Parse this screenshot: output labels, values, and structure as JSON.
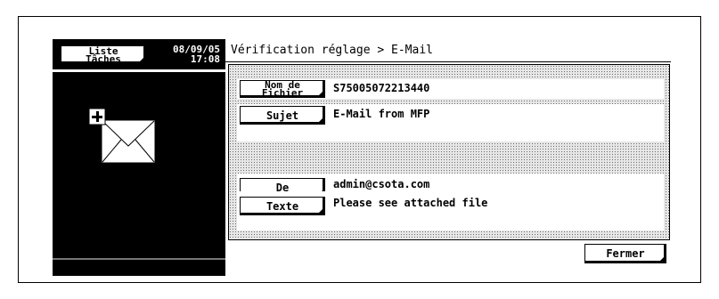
{
  "header": {
    "liste_line1": "Liste",
    "liste_line2": "Tâches",
    "date": "08/09/05",
    "time": "17:08",
    "title": "Vérification réglage > E-Mail"
  },
  "fields": [
    {
      "label_line1": "Nom de",
      "label_line2": "Fichier",
      "value": "S75005072213440"
    },
    {
      "label": "Sujet",
      "value": "E-Mail from MFP"
    },
    {
      "label": "De",
      "value": "admin@csota.com"
    },
    {
      "label": "Texte",
      "value": "Please see attached file"
    }
  ],
  "footer": {
    "close_label": "Fermer"
  },
  "icons": {
    "preview": "envelope-add-icon"
  }
}
